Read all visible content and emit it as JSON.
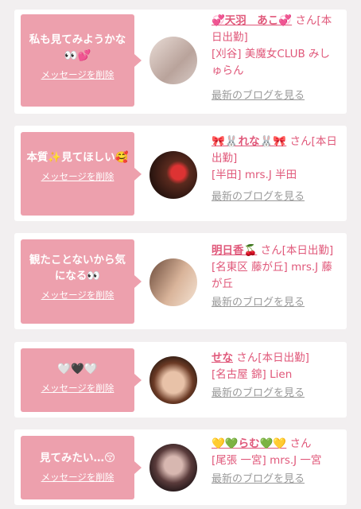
{
  "delete_label": "メッセージを削除",
  "blog_label": "最新のブログを見る",
  "san": "さん",
  "items": [
    {
      "message": "私も見てみようかな👀💕",
      "name": "💞天羽　あこ💞",
      "status": "[本日出勤]",
      "shop": "[刈谷] 美魔女CLUB みしゅらん",
      "avatar_icon": "avatar-photo"
    },
    {
      "message": "本質✨見てほしい🥰",
      "name": "🎀🐰れな🐰🎀",
      "status": "[本日出勤]",
      "shop": "[半田] mrs.J 半田",
      "avatar_icon": "avatar-photo"
    },
    {
      "message": "観たことないから気になる👀",
      "name": "明日香🍒",
      "status": "[本日出勤]",
      "shop": "[名東区 藤が丘] mrs.J 藤が丘",
      "avatar_icon": "avatar-photo"
    },
    {
      "message": "🤍🖤🤍",
      "name": "せな",
      "status": "[本日出勤]",
      "shop": "[名古屋 錦] Lien",
      "avatar_icon": "avatar-photo"
    },
    {
      "message": "見てみたい…😚",
      "name": "💛💚らむ💚💛",
      "status": "",
      "shop": "[尾張 一宮] mrs.J 一宮",
      "avatar_icon": "avatar-photo"
    }
  ]
}
